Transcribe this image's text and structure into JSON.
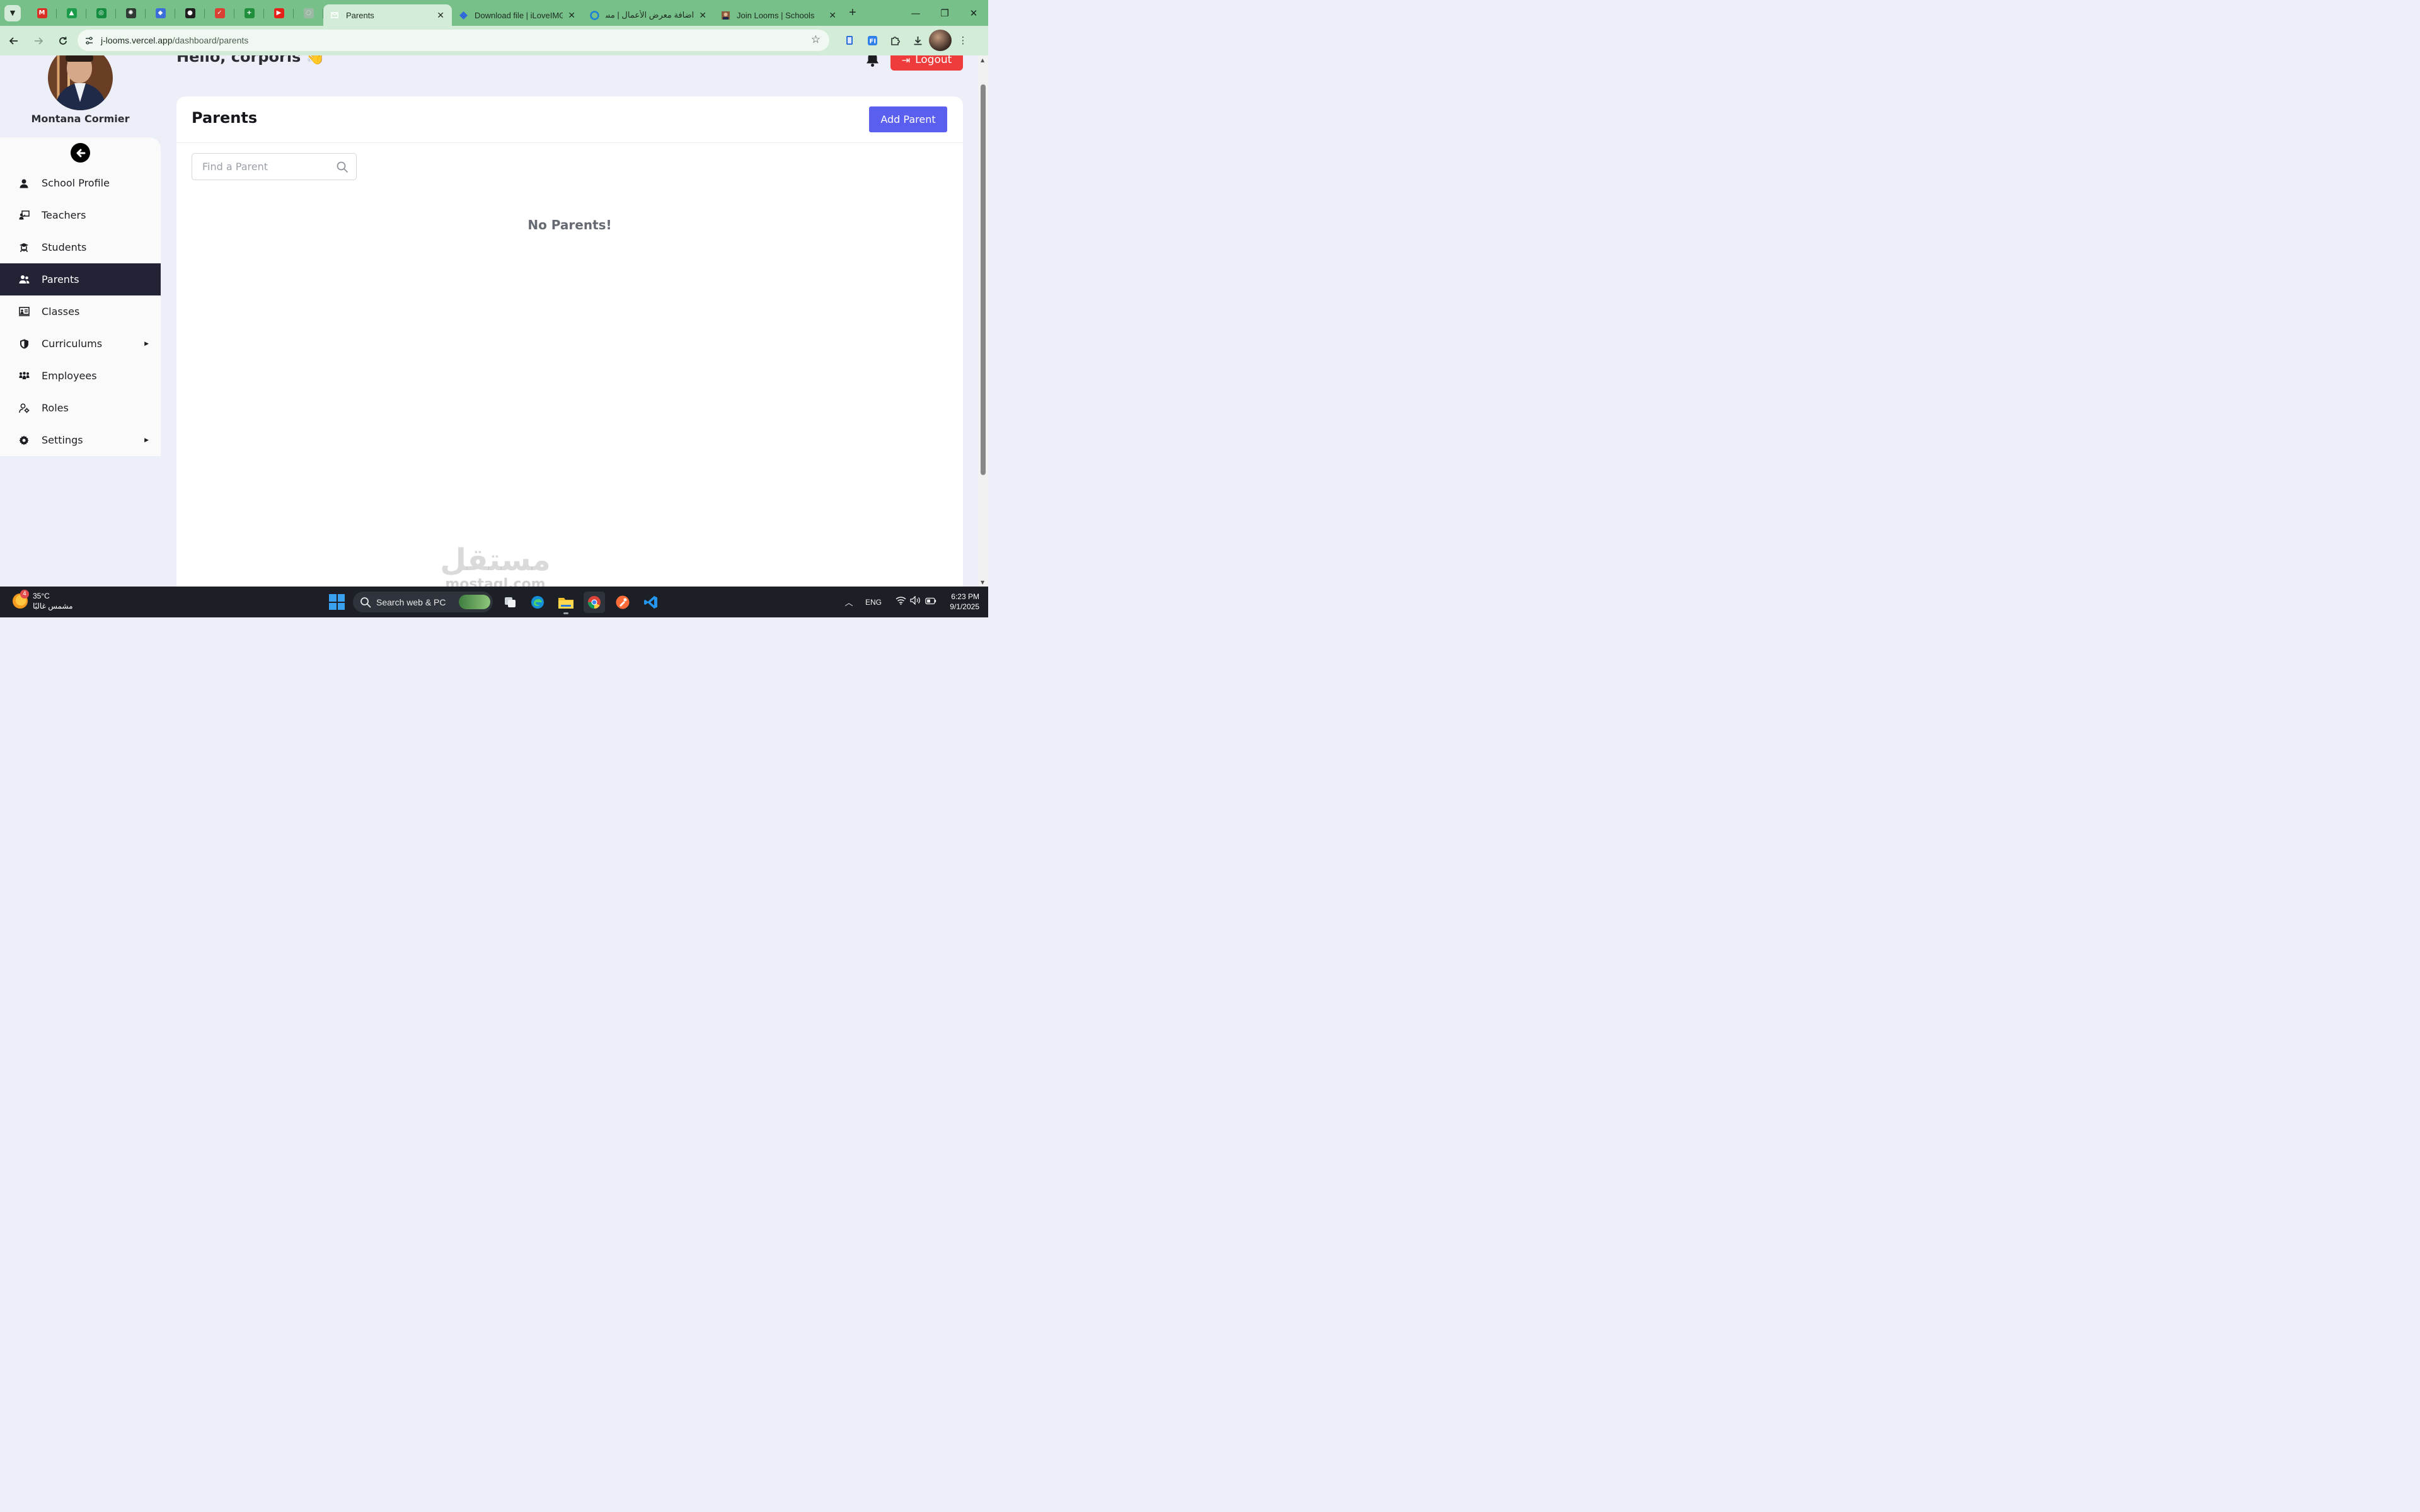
{
  "browser": {
    "pinned_tabs": [
      {
        "icon": "gmail-icon",
        "color": "#d93025",
        "glyph": "M"
      },
      {
        "icon": "google-drive-icon",
        "color": "#1a9c4b",
        "glyph": "▲"
      },
      {
        "icon": "whatsapp-icon",
        "color": "#128c3f",
        "glyph": "◎"
      },
      {
        "icon": "chatgpt-icon",
        "color": "#2f3a33",
        "glyph": "✺"
      },
      {
        "icon": "copilot-icon",
        "color": "#3b6ed8",
        "glyph": "◆"
      },
      {
        "icon": "github-icon",
        "color": "#1f1f1f",
        "glyph": "●"
      },
      {
        "icon": "todoist-icon",
        "color": "#db4035",
        "glyph": "✓"
      },
      {
        "icon": "plus-app-icon",
        "color": "#1f8f3c",
        "glyph": "+"
      },
      {
        "icon": "youtube-icon",
        "color": "#e62117",
        "glyph": "▶"
      },
      {
        "icon": "faded-app-icon",
        "color": "#9bb8a2",
        "glyph": "◌"
      }
    ],
    "tabs": [
      {
        "title": "Parents",
        "active": true,
        "icon": "page-icon"
      },
      {
        "title": "Download file | iLoveIMG",
        "active": false,
        "icon": "ilovimg-icon"
      },
      {
        "title": "اضافة معرض الأعمال | مستقل",
        "active": false,
        "icon": "mostaql-icon"
      },
      {
        "title": "Join Looms | Schools",
        "active": false,
        "icon": "looms-icon"
      }
    ],
    "close_glyph": "✕",
    "new_tab_glyph": "+",
    "url_host": "j-looms.vercel.app",
    "url_path": "/dashboard/parents"
  },
  "profile": {
    "name": "Montana Cormier"
  },
  "sidebar": {
    "items": [
      {
        "label": "School Profile",
        "icon": "user-icon",
        "active": false,
        "has_caret": false
      },
      {
        "label": "Teachers",
        "icon": "chalkboard-teacher-icon",
        "active": false,
        "has_caret": false
      },
      {
        "label": "Students",
        "icon": "graduate-icon",
        "active": false,
        "has_caret": false
      },
      {
        "label": "Parents",
        "icon": "users-icon",
        "active": true,
        "has_caret": false
      },
      {
        "label": "Classes",
        "icon": "classroom-icon",
        "active": false,
        "has_caret": false
      },
      {
        "label": "Curriculums",
        "icon": "shield-icon",
        "active": false,
        "has_caret": true
      },
      {
        "label": "Employees",
        "icon": "people-group-icon",
        "active": false,
        "has_caret": false
      },
      {
        "label": "Roles",
        "icon": "user-gear-icon",
        "active": false,
        "has_caret": false
      },
      {
        "label": "Settings",
        "icon": "gear-icon",
        "active": false,
        "has_caret": true
      }
    ]
  },
  "header": {
    "greeting": "Hello, corporis",
    "wave_emoji": "👋",
    "logout_label": "Logout"
  },
  "main": {
    "title": "Parents",
    "add_button_label": "Add Parent",
    "search_placeholder": "Find a Parent",
    "search_value": "",
    "empty_message": "No Parents!"
  },
  "watermark": {
    "arabic": "مستقل",
    "latin": "mostaql.com"
  },
  "taskbar": {
    "weather_temp": "35°C",
    "weather_desc": "مشمس غالبًا",
    "weather_badge": "4",
    "search_label": "Search web & PC",
    "language": "ENG",
    "time": "6:23 PM",
    "date": "9/1/2025"
  },
  "colors": {
    "tab_bar": "#78c08a",
    "toolbar": "#d3ecd8",
    "page_bg": "#eceef8",
    "sidebar_active": "#222436",
    "logout": "#ef3b3b",
    "primary_button": "#5b5ff0",
    "empty_text": "#666b73"
  }
}
